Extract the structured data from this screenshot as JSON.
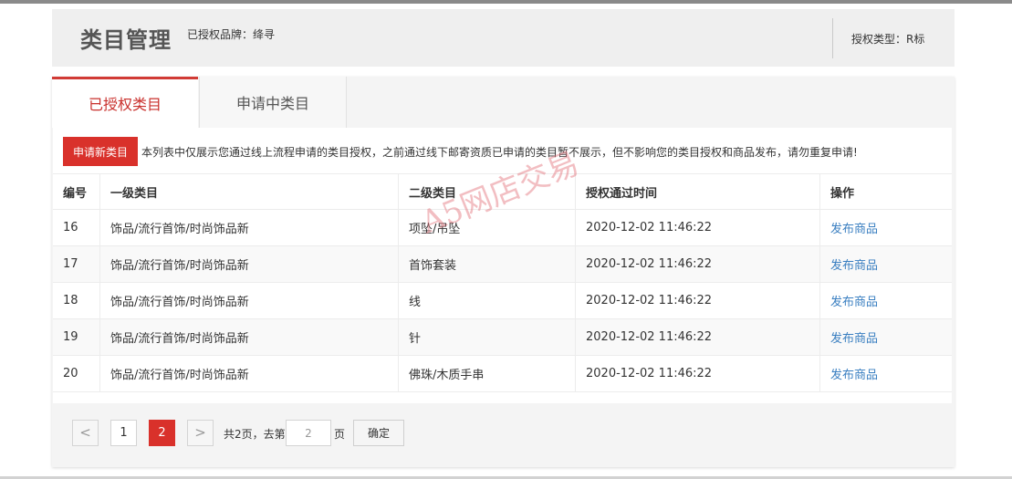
{
  "header": {
    "title": "类目管理",
    "brand_info": "已授权品牌：绛寻",
    "auth_type": "授权类型：R标"
  },
  "tabs": [
    {
      "label": "已授权类目",
      "active": true
    },
    {
      "label": "申请中类目",
      "active": false
    }
  ],
  "notice": {
    "apply_button": "申请新类目",
    "text": "本列表中仅展示您通过线上流程申请的类目授权，之前通过线下邮寄资质已申请的类目暂不展示，但不影响您的类目授权和商品发布，请勿重复申请!"
  },
  "table": {
    "headers": {
      "no": "编号",
      "first": "一级类目",
      "second": "二级类目",
      "time": "授权通过时间",
      "op": "操作"
    },
    "rows": [
      {
        "no": "16",
        "first": "饰品/流行首饰/时尚饰品新",
        "second": "项坠/吊坠",
        "time": "2020-12-02 11:46:22",
        "op": "发布商品"
      },
      {
        "no": "17",
        "first": "饰品/流行首饰/时尚饰品新",
        "second": "首饰套装",
        "time": "2020-12-02 11:46:22",
        "op": "发布商品"
      },
      {
        "no": "18",
        "first": "饰品/流行首饰/时尚饰品新",
        "second": "线",
        "time": "2020-12-02 11:46:22",
        "op": "发布商品"
      },
      {
        "no": "19",
        "first": "饰品/流行首饰/时尚饰品新",
        "second": "针",
        "time": "2020-12-02 11:46:22",
        "op": "发布商品"
      },
      {
        "no": "20",
        "first": "饰品/流行首饰/时尚饰品新",
        "second": "佛珠/木质手串",
        "time": "2020-12-02 11:46:22",
        "op": "发布商品"
      }
    ]
  },
  "pagination": {
    "prev": "<",
    "next": ">",
    "pages": [
      "1",
      "2"
    ],
    "current": "2",
    "total_text": "共2页，去第",
    "input_value": "2",
    "page_suffix": "页",
    "confirm": "确定"
  },
  "watermark": "A5网店交易",
  "colors": {
    "accent": "#d9312b",
    "link": "#3a7fc1"
  }
}
